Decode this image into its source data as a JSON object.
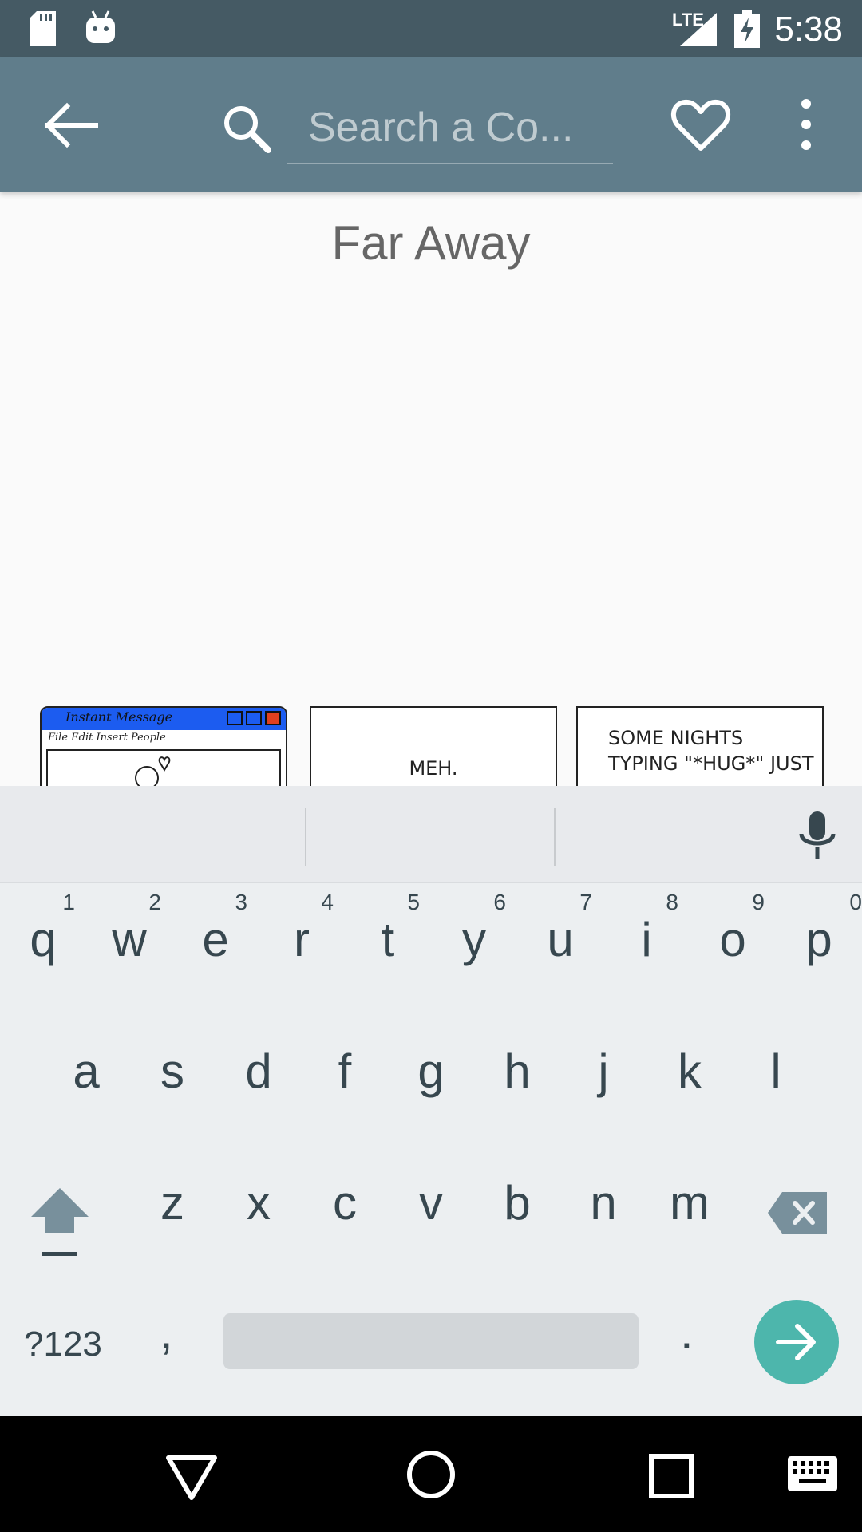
{
  "status_bar": {
    "time": "5:38",
    "network": "LTE",
    "icons": [
      "sd-card-icon",
      "android-debug-icon",
      "signal-icon",
      "battery-charging-icon"
    ]
  },
  "toolbar": {
    "back_icon": "arrow-back-icon",
    "search_icon": "search-icon",
    "search_placeholder": "Search a Co...",
    "favorite_icon": "heart-outline-icon",
    "more_icon": "more-vert-icon",
    "color": "#607d8b"
  },
  "comic": {
    "title": "Far Away",
    "panels": [
      {
        "window_title": "Instant Message",
        "menu": "File  Edit  Insert  People"
      },
      {
        "text": "MEH."
      },
      {
        "text_line1": "SOME NIGHTS",
        "text_line2": "TYPING \"*HUG*\" JUST"
      }
    ]
  },
  "keyboard": {
    "row1": [
      {
        "key": "q",
        "hint": "1"
      },
      {
        "key": "w",
        "hint": "2"
      },
      {
        "key": "e",
        "hint": "3"
      },
      {
        "key": "r",
        "hint": "4"
      },
      {
        "key": "t",
        "hint": "5"
      },
      {
        "key": "y",
        "hint": "6"
      },
      {
        "key": "u",
        "hint": "7"
      },
      {
        "key": "i",
        "hint": "8"
      },
      {
        "key": "o",
        "hint": "9"
      },
      {
        "key": "p",
        "hint": "0"
      }
    ],
    "row2": [
      "a",
      "s",
      "d",
      "f",
      "g",
      "h",
      "j",
      "k",
      "l"
    ],
    "row3": [
      "z",
      "x",
      "c",
      "v",
      "b",
      "n",
      "m"
    ],
    "symbols_label": "?123",
    "comma_label": ",",
    "period_label": ".",
    "enter_color": "#4db6ac"
  },
  "nav_bar": {
    "buttons": [
      "back-triangle-icon",
      "home-circle-icon",
      "recents-square-icon",
      "keyboard-switch-icon"
    ]
  }
}
